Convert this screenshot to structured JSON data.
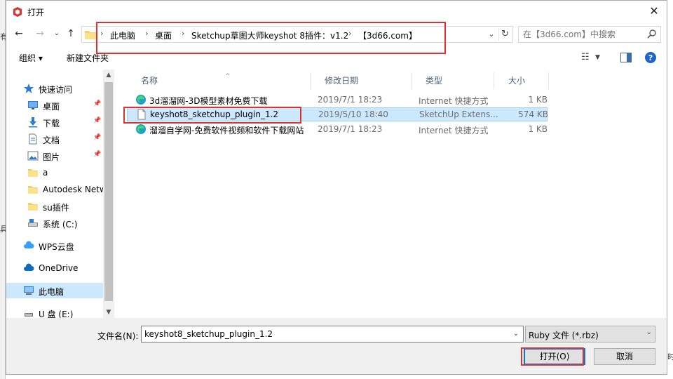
{
  "window": {
    "title": "打开"
  },
  "nav": {
    "breadcrumbs": [
      "此电脑",
      "桌面",
      "Sketchup草图大师keyshot 8插件：v1.2",
      "【3d66.com】"
    ],
    "search_placeholder": "在【3d66.com】中搜索"
  },
  "toolbar": {
    "organize": "组织 ▾",
    "new_folder": "新建文件夹"
  },
  "navpane": {
    "items": [
      {
        "label": "快速访问",
        "icon": "star-icon"
      },
      {
        "label": "桌面",
        "icon": "desktop-icon",
        "pinned": true
      },
      {
        "label": "下载",
        "icon": "download-icon",
        "pinned": true
      },
      {
        "label": "文档",
        "icon": "document-icon",
        "pinned": true
      },
      {
        "label": "图片",
        "icon": "picture-icon",
        "pinned": true
      },
      {
        "label": "a",
        "icon": "folder-icon"
      },
      {
        "label": "Autodesk Netw",
        "icon": "folder-icon"
      },
      {
        "label": "su插件",
        "icon": "folder-icon"
      },
      {
        "label": "系统 (C:)",
        "icon": "drive-icon"
      },
      {
        "label": "WPS云盘",
        "icon": "cloud-icon"
      },
      {
        "label": "OneDrive",
        "icon": "onedrive-icon"
      },
      {
        "label": "此电脑",
        "icon": "computer-icon",
        "selected": true
      },
      {
        "label": "U 盘 (E:)",
        "icon": "usb-drive-icon"
      }
    ]
  },
  "filelist": {
    "columns": {
      "name": "名称",
      "date": "修改日期",
      "type": "类型",
      "size": "大小"
    },
    "rows": [
      {
        "name": "3d溜溜网-3D模型素材免费下载",
        "date": "2019/7/1 18:23",
        "type": "Internet 快捷方式",
        "size": "1 KB",
        "icon": "edge-shortcut-icon"
      },
      {
        "name": "keyshot8_sketchup_plugin_1.2",
        "date": "2019/5/10 18:40",
        "type": "SketchUp Extens...",
        "size": "574 KB",
        "icon": "file-icon",
        "selected": true
      },
      {
        "name": "溜溜自学网-免费软件视频和软件下载网站",
        "date": "2019/7/1 18:23",
        "type": "Internet 快捷方式",
        "size": "1 KB",
        "icon": "edge-shortcut-icon"
      }
    ]
  },
  "bottom": {
    "filename_label": "文件名(N):",
    "filename_value": "keyshot8_sketchup_plugin_1.2",
    "filter_value": "Ruby 文件 (*.rbz)",
    "open_label": "打开(O)",
    "cancel_label": "取消"
  },
  "background": {
    "left_chars": [
      "有",
      "具"
    ],
    "right_chars": [
      "时"
    ]
  },
  "colors": {
    "selection": "#cce8ff",
    "highlight_box": "#e0312f",
    "accent": "#0078d7"
  }
}
